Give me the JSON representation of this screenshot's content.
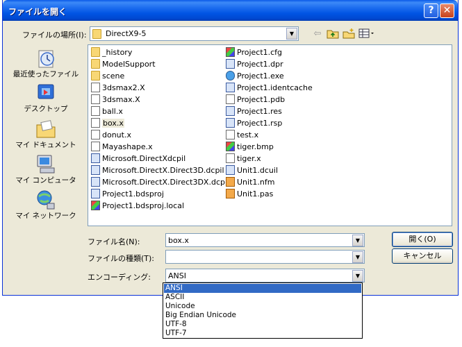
{
  "window": {
    "title": "ファイルを開く",
    "help_glyph": "?",
    "close_glyph": "✕"
  },
  "lookin": {
    "label": "ファイルの場所(I):",
    "value": "DirectX9-5"
  },
  "places": [
    {
      "label": "最近使ったファイル",
      "icon": "recent-files-icon"
    },
    {
      "label": "デスクトップ",
      "icon": "desktop-icon"
    },
    {
      "label": "マイ ドキュメント",
      "icon": "my-documents-icon"
    },
    {
      "label": "マイ コンピュータ",
      "icon": "my-computer-icon"
    },
    {
      "label": "マイ ネットワーク",
      "icon": "my-network-icon"
    }
  ],
  "files_col1": [
    {
      "name": "_history",
      "type": "folder"
    },
    {
      "name": "ModelSupport",
      "type": "folder"
    },
    {
      "name": "scene",
      "type": "folder"
    },
    {
      "name": "3dsmax2.X",
      "type": "doc"
    },
    {
      "name": "3dsmax.X",
      "type": "doc"
    },
    {
      "name": "ball.x",
      "type": "doc"
    },
    {
      "name": "box.x",
      "type": "doc"
    },
    {
      "name": "donut.x",
      "type": "doc"
    },
    {
      "name": "Mayashape.x",
      "type": "doc"
    },
    {
      "name": "Microsoft.DirectXdcpil",
      "type": "app"
    },
    {
      "name": "Microsoft.DirectX.Direct3D.dcpil",
      "type": "app"
    },
    {
      "name": "Microsoft.DirectX.Direct3DX.dcpil",
      "type": "app"
    },
    {
      "name": "Project1.bdsproj",
      "type": "app"
    },
    {
      "name": "Project1.bdsproj.local",
      "type": "color"
    }
  ],
  "files_col2": [
    {
      "name": "Project1.cfg",
      "type": "color"
    },
    {
      "name": "Project1.dpr",
      "type": "app"
    },
    {
      "name": "Project1.exe",
      "type": "globe"
    },
    {
      "name": "Project1.identcache",
      "type": "app"
    },
    {
      "name": "Project1.pdb",
      "type": "doc"
    },
    {
      "name": "Project1.res",
      "type": "app"
    },
    {
      "name": "Project1.rsp",
      "type": "app"
    },
    {
      "name": "test.x",
      "type": "doc"
    },
    {
      "name": "tiger.bmp",
      "type": "color"
    },
    {
      "name": "tiger.x",
      "type": "doc"
    },
    {
      "name": "Unit1.dcuil",
      "type": "app"
    },
    {
      "name": "Unit1.nfm",
      "type": "orange"
    },
    {
      "name": "Unit1.pas",
      "type": "orange"
    }
  ],
  "selected_file": "box.x",
  "filename": {
    "label": "ファイル名(N):",
    "value": "box.x"
  },
  "filetype": {
    "label": "ファイルの種類(T):",
    "value": ""
  },
  "encoding": {
    "label": "エンコーディング:",
    "value": "ANSI",
    "options": [
      "ANSI",
      "ASCII",
      "Unicode",
      "Big Endian Unicode",
      "UTF-8",
      "UTF-7"
    ],
    "selected_index": 0
  },
  "buttons": {
    "open": "開く(O)",
    "cancel": "キャンセル"
  },
  "toolbar_icons": [
    "back-arrow-icon",
    "up-folder-icon",
    "new-folder-icon",
    "views-menu-icon"
  ],
  "colors": {
    "title_bar": "#0054e3",
    "dialog_bg": "#ece9d8",
    "selection": "#316ac5"
  }
}
